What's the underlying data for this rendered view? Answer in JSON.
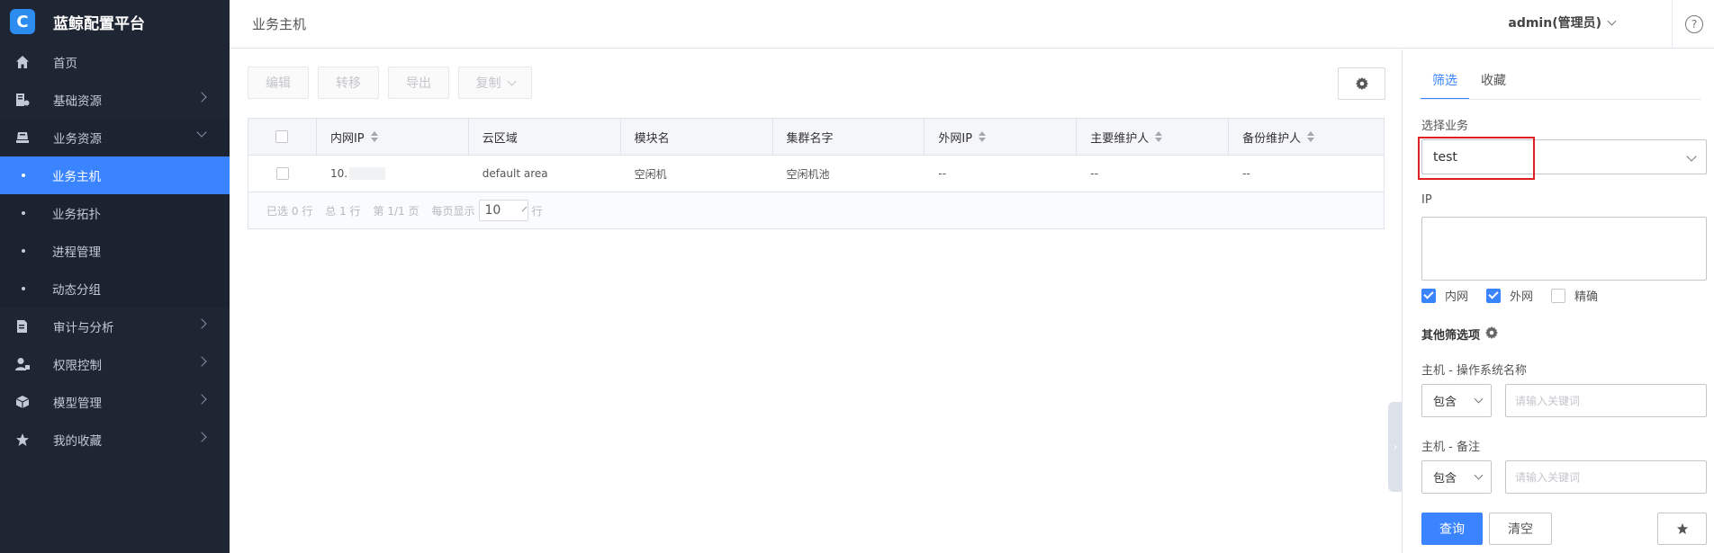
{
  "app": {
    "title": "蓝鲸配置平台",
    "logo_letter": "C"
  },
  "sidebar": {
    "items": [
      {
        "label": "首页",
        "icon": "home-icon"
      },
      {
        "label": "基础资源",
        "icon": "resource-icon"
      },
      {
        "label": "业务资源",
        "icon": "business-icon"
      },
      {
        "label": "审计与分析",
        "icon": "audit-icon"
      },
      {
        "label": "权限控制",
        "icon": "permission-icon"
      },
      {
        "label": "模型管理",
        "icon": "model-icon"
      },
      {
        "label": "我的收藏",
        "icon": "star-icon"
      }
    ],
    "sub_items": [
      {
        "label": "业务主机"
      },
      {
        "label": "业务拓扑"
      },
      {
        "label": "进程管理"
      },
      {
        "label": "动态分组"
      }
    ]
  },
  "header": {
    "title": "业务主机",
    "user": "admin(管理员)",
    "help": "?"
  },
  "toolbar": {
    "edit": "编辑",
    "transfer": "转移",
    "export": "导出",
    "copy": "复制"
  },
  "table": {
    "columns": [
      "内网IP",
      "云区域",
      "模块名",
      "集群名字",
      "外网IP",
      "主要维护人",
      "备份维护人"
    ],
    "rows": [
      [
        "10.",
        "default area",
        "空闲机",
        "空闲机池",
        "--",
        "--",
        "--"
      ]
    ]
  },
  "pager": {
    "selected": "已选 0 行",
    "total": "总 1 行",
    "page": "第 1/1 页",
    "per_page_prefix": "每页显示",
    "per_page_value": "10",
    "per_page_suffix": "行"
  },
  "filter": {
    "tabs": [
      "筛选",
      "收藏"
    ],
    "business_label": "选择业务",
    "business_value": "test",
    "ip_label": "IP",
    "checkboxes": [
      {
        "label": "内网",
        "checked": true
      },
      {
        "label": "外网",
        "checked": true
      },
      {
        "label": "精确",
        "checked": false
      }
    ],
    "other_title": "其他筛选项",
    "os_label": "主机 - 操作系统名称",
    "remark_label": "主机 - 备注",
    "operator": "包含",
    "placeholder": "请输入关键词",
    "query_btn": "查询",
    "clear_btn": "清空"
  },
  "colors": {
    "accent": "#3a84ff",
    "sidebar_bg": "#1e2533",
    "highlight": "#e02020"
  }
}
